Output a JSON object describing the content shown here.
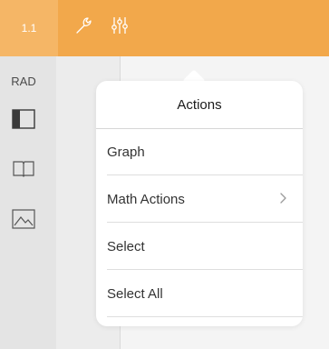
{
  "toolbar": {
    "page_label": "1.1",
    "wrench_icon": "wrench-icon",
    "settings_icon": "sliders-icon",
    "color": "#f2a84b"
  },
  "sidebar": {
    "mode_label": "RAD",
    "icons": [
      "layout-panel-icon",
      "book-icon",
      "graph-mountain-icon"
    ]
  },
  "popover": {
    "title": "Actions",
    "items": [
      {
        "label": "Graph"
      },
      {
        "label": "Math Actions",
        "has_submenu": true
      },
      {
        "label": "Select"
      },
      {
        "label": "Select All"
      }
    ]
  }
}
